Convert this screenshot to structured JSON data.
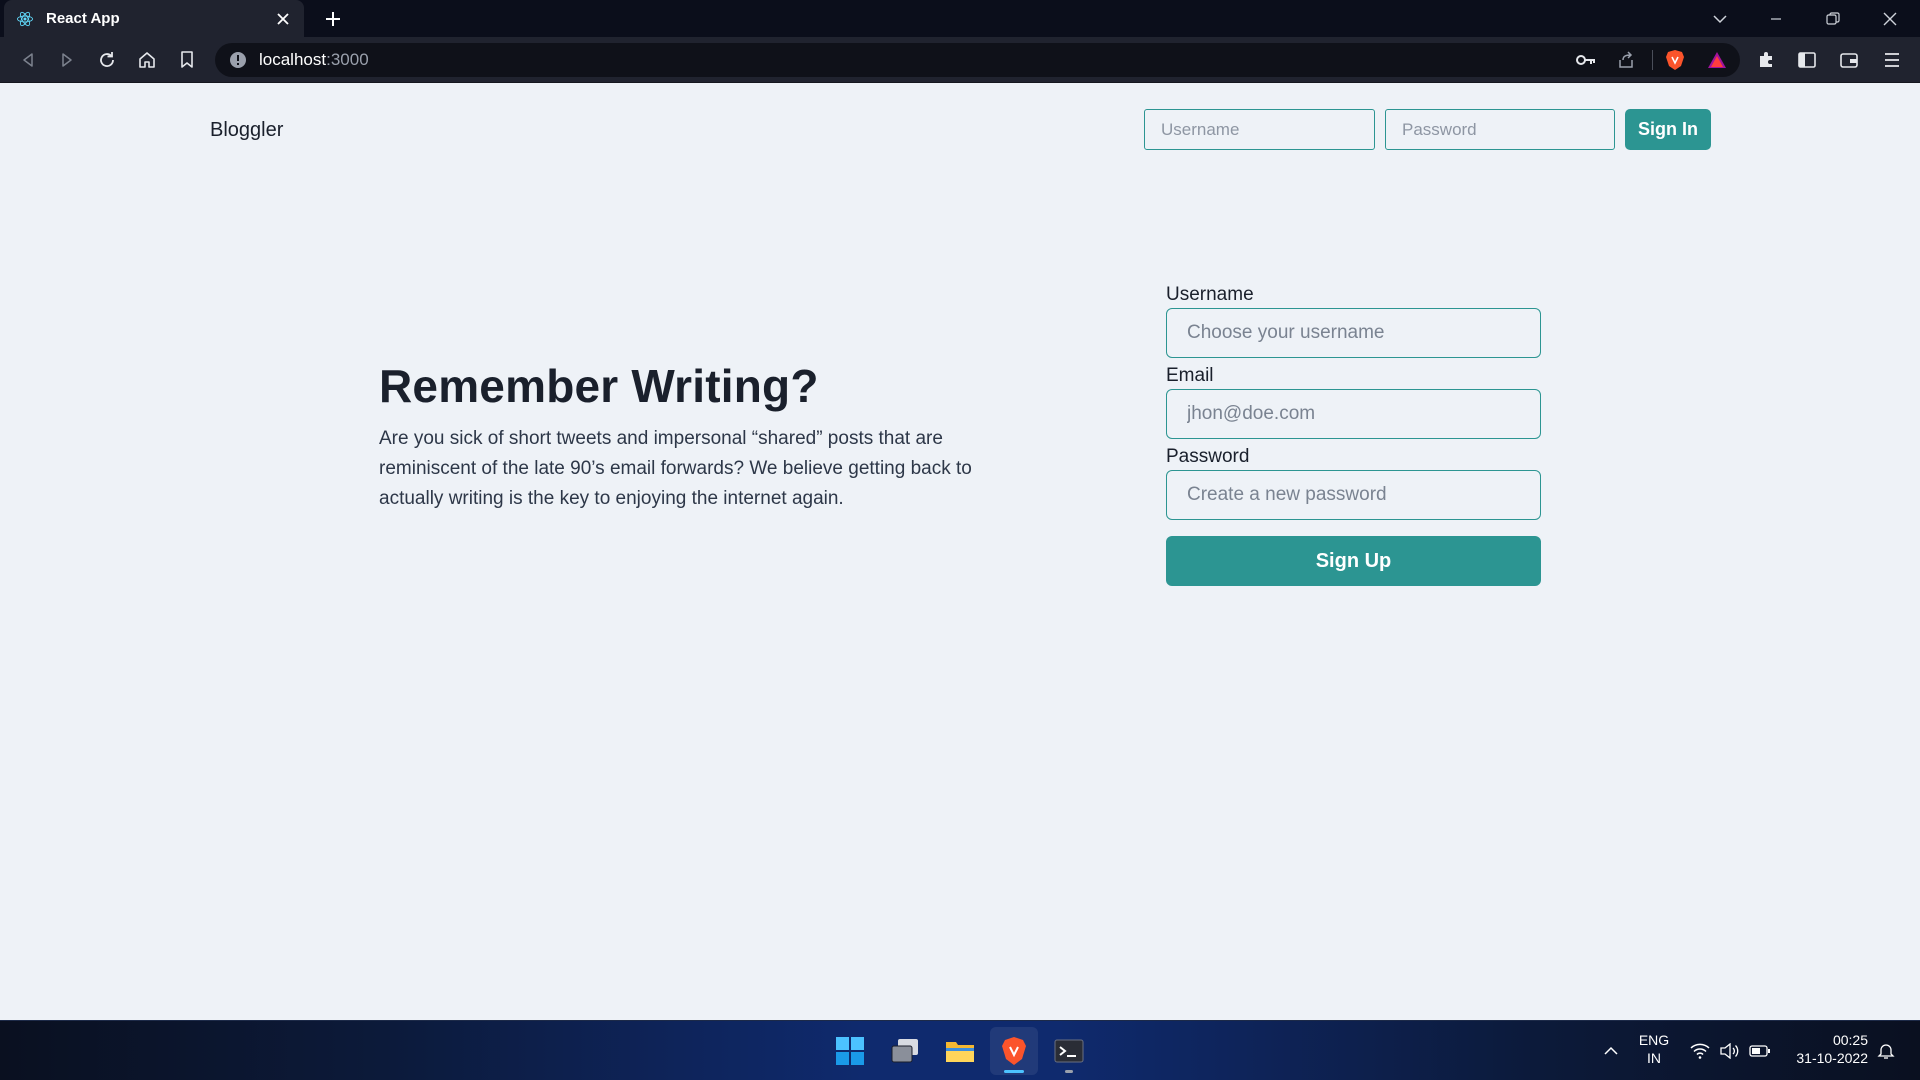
{
  "browser": {
    "tab_title": "React App",
    "url_host": "localhost",
    "url_port": ":3000"
  },
  "app": {
    "brand": "Bloggler",
    "header": {
      "username_placeholder": "Username",
      "password_placeholder": "Password",
      "signin_label": "Sign In"
    },
    "hero": {
      "title": "Remember Writing?",
      "body": "Are you sick of short tweets and impersonal “shared” posts that are reminiscent of the late 90’s email forwards? We believe getting back to actually writing is the key to enjoying the internet again."
    },
    "signup_form": {
      "username_label": "Username",
      "username_placeholder": "Choose your username",
      "email_label": "Email",
      "email_placeholder": "jhon@doe.com",
      "password_label": "Password",
      "password_placeholder": "Create a new password",
      "submit_label": "Sign Up"
    }
  },
  "taskbar": {
    "language_line1": "ENG",
    "language_line2": "IN",
    "time": "00:25",
    "date": "31-10-2022"
  },
  "colors": {
    "accent": "#2c9592",
    "page_bg": "#eef2f7",
    "text": "#1a202c"
  }
}
